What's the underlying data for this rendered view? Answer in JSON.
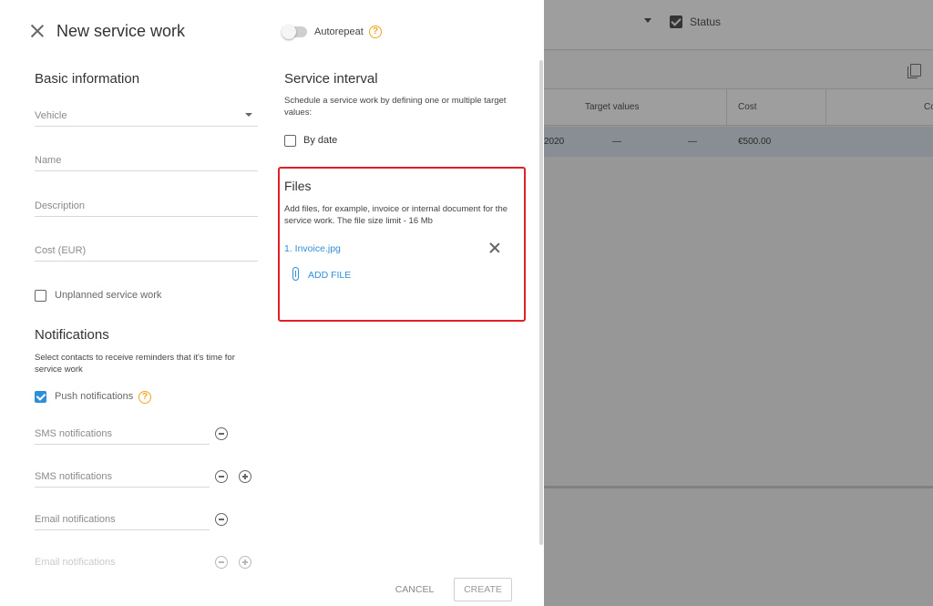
{
  "background": {
    "status_label": "Status",
    "table": {
      "headers": [
        "Target values",
        "Cost",
        "Co"
      ],
      "row": [
        "2020",
        "—",
        "—",
        "€500.00"
      ]
    }
  },
  "drawer": {
    "title": "New service work",
    "basic": {
      "title": "Basic information",
      "vehicle_placeholder": "Vehicle",
      "name_placeholder": "Name",
      "description_placeholder": "Description",
      "cost_placeholder": "Cost (EUR)",
      "unplanned_label": "Unplanned service work",
      "unplanned_checked": false
    },
    "notifications": {
      "title": "Notifications",
      "description": "Select contacts to receive reminders that it's time for service work",
      "push_label": "Push notifications",
      "push_checked": true,
      "sms_placeholder_1": "SMS notifications",
      "sms_placeholder_2": "SMS notifications",
      "email_placeholder_1": "Email notifications",
      "email_placeholder_2": "Email notifications"
    },
    "autorepeat": {
      "label": "Autorepeat",
      "enabled": false
    },
    "service_interval": {
      "title": "Service interval",
      "description": "Schedule a service work by defining one or multiple target values:",
      "by_date_label": "By date",
      "by_date_checked": false
    },
    "files": {
      "title": "Files",
      "description": "Add files, for example, invoice or internal document for the service work. The file size limit - 16 Mb",
      "items": [
        "1. Invoice.jpg"
      ],
      "add_label": "ADD FILE"
    },
    "footer": {
      "cancel_label": "CANCEL",
      "create_label": "CREATE"
    }
  },
  "colors": {
    "accent": "#2f8ed8",
    "help": "#f2a51a",
    "highlight": "#e01f26"
  },
  "icons": [
    "close-icon",
    "help-icon",
    "paperclip-icon",
    "remove-icon",
    "minus-circle-icon",
    "plus-circle-icon",
    "chevron-down-icon",
    "copy-icon",
    "checkbox-icon"
  ]
}
